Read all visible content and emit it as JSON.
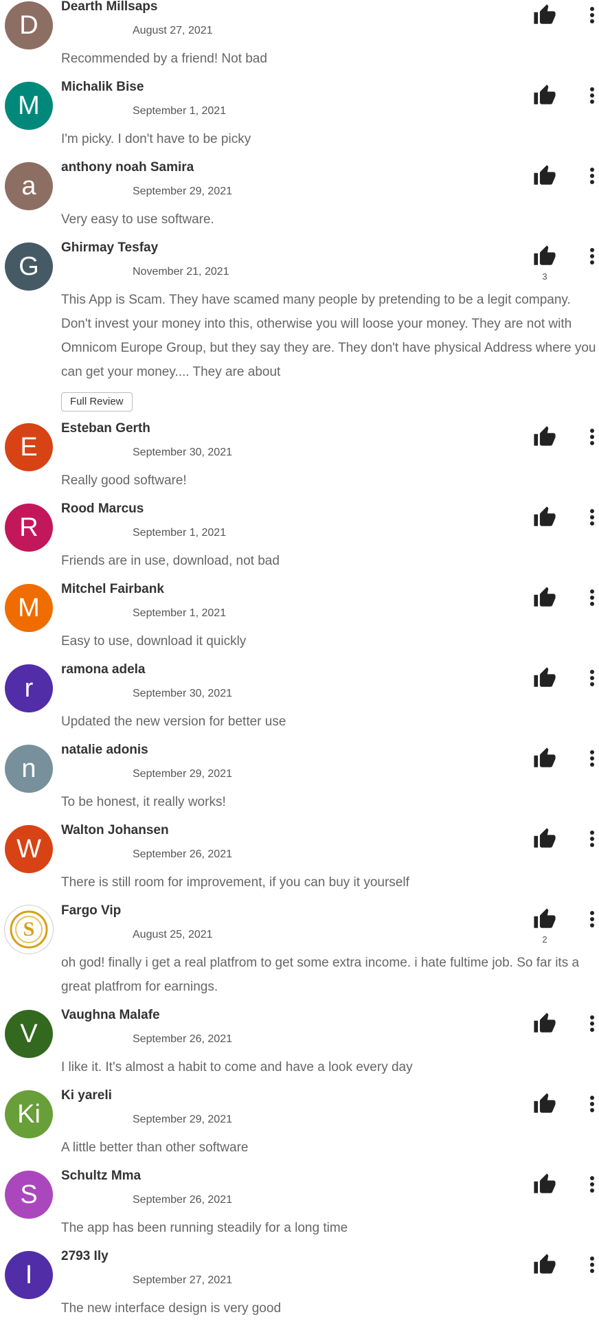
{
  "reviews": [
    {
      "avatar_letter": "D",
      "avatar_color": "#8d6e63",
      "name": "Dearth Millsaps",
      "date": "August 27, 2021",
      "text": [
        "Recommended by a friend! Not bad"
      ],
      "likes": ""
    },
    {
      "avatar_letter": "M",
      "avatar_color": "#00897b",
      "name": "Michalik Bise",
      "date": "September 1, 2021",
      "text": [
        "I'm picky. I don't have to be picky"
      ],
      "likes": ""
    },
    {
      "avatar_letter": "a",
      "avatar_color": "#8d6e63",
      "name": "anthony noah Samira",
      "date": "September 29, 2021",
      "text": [
        "Very easy to use software."
      ],
      "likes": ""
    },
    {
      "avatar_letter": "G",
      "avatar_color": "#455a64",
      "name": "Ghirmay Tesfay",
      "date": "November 21, 2021",
      "text": [
        "This App is Scam. They have scamed many people by pretending to be a legit company.",
        "Don't invest your money into this, otherwise you will loose your money. They are not with",
        "Omnicom Europe Group, but they say they are. They don't have physical Address where you",
        "can get your money.... They are about"
      ],
      "likes": "3",
      "full_review_label": "Full Review"
    },
    {
      "avatar_letter": "E",
      "avatar_color": "#d84315",
      "name": "Esteban Gerth",
      "date": "September 30, 2021",
      "text": [
        "Really good software!"
      ],
      "likes": ""
    },
    {
      "avatar_letter": "R",
      "avatar_color": "#c2185b",
      "name": "Rood Marcus",
      "date": "September 1, 2021",
      "text": [
        "Friends are in use, download, not bad"
      ],
      "likes": ""
    },
    {
      "avatar_letter": "M",
      "avatar_color": "#ef6c00",
      "name": "Mitchel Fairbank",
      "date": "September 1, 2021",
      "text": [
        "Easy to use, download it quickly"
      ],
      "likes": ""
    },
    {
      "avatar_letter": "r",
      "avatar_color": "#512da8",
      "name": "ramona adela",
      "date": "September 30, 2021",
      "text": [
        "Updated the new version for better use"
      ],
      "likes": ""
    },
    {
      "avatar_letter": "n",
      "avatar_color": "#78909c",
      "name": "natalie adonis",
      "date": "September 29, 2021",
      "text": [
        "To be honest, it really works!"
      ],
      "likes": ""
    },
    {
      "avatar_letter": "W",
      "avatar_color": "#d84315",
      "name": "Walton Johansen",
      "date": "September 26, 2021",
      "text": [
        "There is still room for improvement, if you can buy it yourself"
      ],
      "likes": ""
    },
    {
      "avatar_letter": "",
      "avatar_color": "#ffffff",
      "avatar_logo": "S",
      "name": "Fargo Vip",
      "date": "August 25, 2021",
      "text": [
        "oh god! finally i get a real platfrom to get some extra income. i hate fultime job. So far its a",
        "great platfrom for earnings."
      ],
      "likes": "2"
    },
    {
      "avatar_letter": "V",
      "avatar_color": "#33691e",
      "name": "Vaughna Malafe",
      "date": "September 26, 2021",
      "text": [
        "I like it. It's almost a habit to come and have a look every day"
      ],
      "likes": ""
    },
    {
      "avatar_letter": "Ki",
      "avatar_color": "#689f38",
      "name": "Ki yareli",
      "date": "September 29, 2021",
      "text": [
        "A little better than other software"
      ],
      "likes": ""
    },
    {
      "avatar_letter": "S",
      "avatar_color": "#ab47bc",
      "name": "Schultz Mma",
      "date": "September 26, 2021",
      "text": [
        "The app has been running steadily for a long time"
      ],
      "likes": ""
    },
    {
      "avatar_letter": "I",
      "avatar_color": "#512da8",
      "name": "2793 Ily",
      "date": "September 27, 2021",
      "text": [
        "The new interface design is very good"
      ],
      "likes": ""
    }
  ],
  "icons": {
    "like": "thumb-up-icon",
    "menu": "more-vert-icon"
  }
}
